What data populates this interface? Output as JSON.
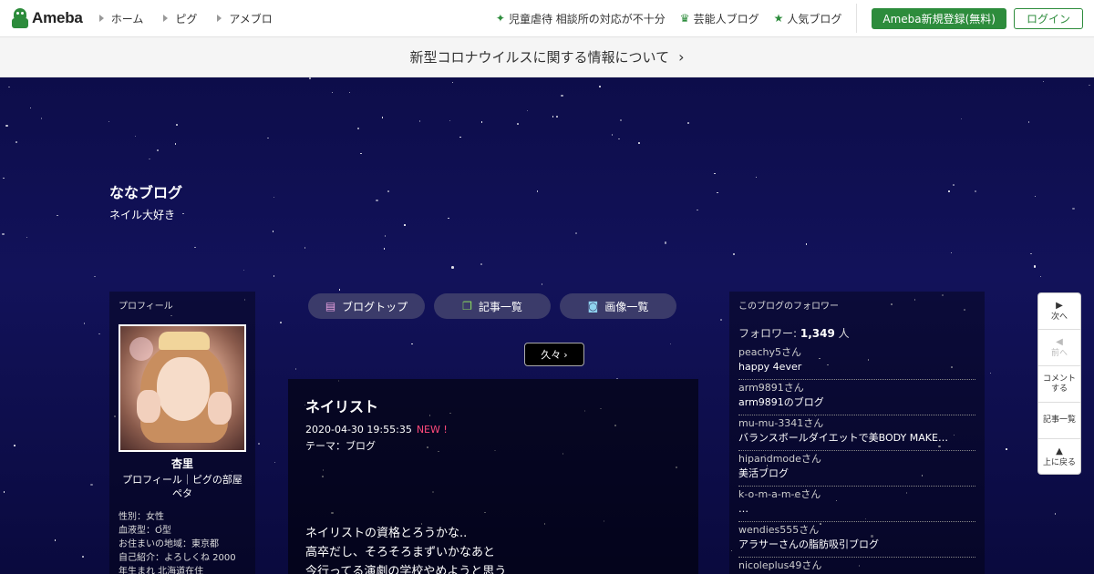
{
  "header": {
    "logo_text": "Ameba",
    "nav": [
      {
        "label": "ホーム"
      },
      {
        "label": "ピグ"
      },
      {
        "label": "アメブロ"
      }
    ],
    "links": [
      {
        "label": "児童虐待 相談所の対応が不十分",
        "icon": "sparkle-icon"
      },
      {
        "label": "芸能人ブログ",
        "icon": "crown-icon"
      },
      {
        "label": "人気ブログ",
        "icon": "star-icon"
      }
    ],
    "register_label": "Ameba新規登録(無料)",
    "login_label": "ログイン"
  },
  "notice": {
    "text": "新型コロナウイルスに関する情報について"
  },
  "blog": {
    "title": "ななブログ",
    "subtitle": "ネイル大好き"
  },
  "profile": {
    "heading": "プロフィール",
    "name": "杏里",
    "links_line1": "プロフィール｜ピグの部屋",
    "links_line2": "ペタ",
    "info": [
      "性別：女性",
      "血液型：O型",
      "お住まいの地域：東京都",
      "自己紹介：よろしくね 2000",
      "年生まれ 北海道在住"
    ]
  },
  "tabs": [
    {
      "label": "ブログトップ",
      "icon": "document-icon"
    },
    {
      "label": "記事一覧",
      "icon": "copy-icon"
    },
    {
      "label": "画像一覧",
      "icon": "camera-icon"
    }
  ],
  "hisashi_label": "久々",
  "article": {
    "title": "ネイリスト",
    "date": "2020-04-30 19:55:35",
    "new_label": "NEW !",
    "theme": "テーマ：ブログ",
    "body": [
      "ネイリストの資格とろうかな..",
      "高卒だし、そろそろまずいかなあと",
      "今行ってる演劇の学校やめようと思う"
    ]
  },
  "followers": {
    "heading": "このブログのフォロワー",
    "count_prefix": "フォロワー: ",
    "count": "1,349",
    "count_suffix": " 人",
    "items": [
      {
        "user": "peachy5さん",
        "blog": "happy 4ever"
      },
      {
        "user": "arm9891さん",
        "blog": "arm9891のブログ"
      },
      {
        "user": "mu-mu-3341さん",
        "blog": "バランスボールダイエットで美BODY MAKE…"
      },
      {
        "user": "hipandmodeさん",
        "blog": "美活ブログ"
      },
      {
        "user": "k-o-m-a-m-eさん",
        "blog": "…"
      },
      {
        "user": "wendies555さん",
        "blog": "アラサーさんの脂肪吸引ブログ"
      },
      {
        "user": "nicoleplus49さん",
        "blog": ""
      }
    ]
  },
  "side_menu": [
    {
      "label": "次へ",
      "icon": "play-right-icon",
      "disabled": false
    },
    {
      "label": "前へ",
      "icon": "play-left-icon",
      "disabled": true
    },
    {
      "label": "コメントする",
      "icon": "",
      "disabled": false
    },
    {
      "label": "記事一覧",
      "icon": "",
      "disabled": false
    },
    {
      "label": "上に戻る",
      "icon": "up-arrow-icon",
      "disabled": false
    }
  ],
  "colors": {
    "brand_green": "#2d8c3c",
    "new_pink": "#ff4a7a",
    "sky": "#0d0d4a"
  }
}
